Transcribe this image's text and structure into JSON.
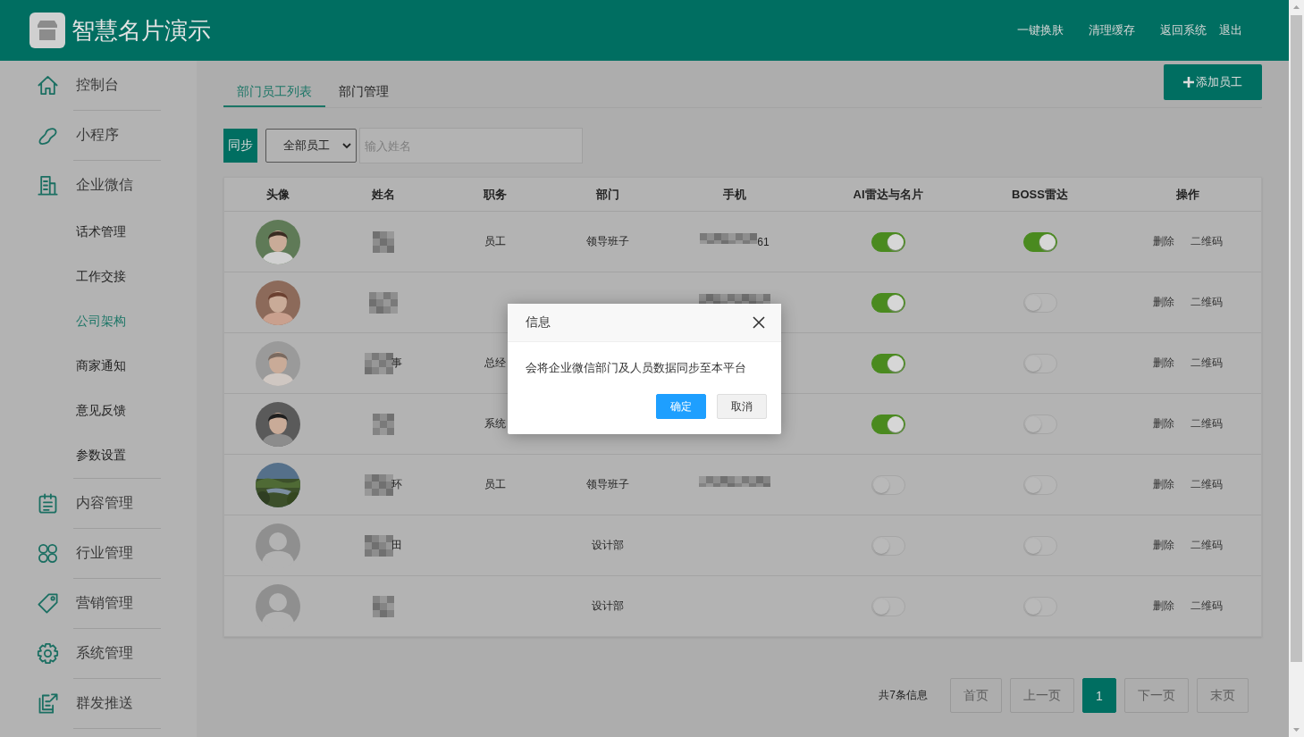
{
  "header": {
    "title": "智慧名片演示",
    "links": [
      "一键换肤",
      "清理缓存",
      "返回系统",
      "退出"
    ]
  },
  "sidebar": {
    "items": [
      {
        "label": "控制台",
        "selected": false
      },
      {
        "label": "小程序",
        "selected": false
      },
      {
        "label": "企业微信",
        "selected": false,
        "children": [
          {
            "label": "话术管理",
            "selected": false
          },
          {
            "label": "工作交接",
            "selected": false
          },
          {
            "label": "公司架构",
            "selected": true
          },
          {
            "label": "商家通知",
            "selected": false
          },
          {
            "label": "意见反馈",
            "selected": false
          },
          {
            "label": "参数设置",
            "selected": false
          }
        ]
      },
      {
        "label": "内容管理",
        "selected": false
      },
      {
        "label": "行业管理",
        "selected": false
      },
      {
        "label": "营销管理",
        "selected": false
      },
      {
        "label": "系统管理",
        "selected": false
      },
      {
        "label": "群发推送",
        "selected": false
      }
    ]
  },
  "tabs": [
    {
      "label": "部门员工列表",
      "selected": true
    },
    {
      "label": "部门管理",
      "selected": false
    }
  ],
  "add_button": "添加员工",
  "filter": {
    "sync_button": "同步",
    "select": "全部员工",
    "search": {
      "placeholder": "输入姓名"
    }
  },
  "table": {
    "columns": [
      "头像",
      "姓名",
      "职务",
      "部门",
      "手机",
      "AI雷达与名片",
      "BOSS雷达",
      "操作"
    ],
    "rows": [
      {
        "position": "员工",
        "department": "领导班子",
        "phone": {
          "blurred": true,
          "text": "61"
        },
        "ai_radar": true,
        "boss_radar": true,
        "actions": [
          "删除",
          "二维码"
        ]
      },
      {
        "phone": {
          "blurred": true
        },
        "ai_radar": true,
        "boss_radar": false,
        "actions": [
          "删除",
          "二维码"
        ]
      },
      {
        "name": "事",
        "position": "总经",
        "phone": {
          "blurred": false
        },
        "ai_radar": true,
        "boss_radar": false,
        "actions": [
          "删除",
          "二维码"
        ]
      },
      {
        "position": "系统",
        "phone": {
          "blurred": false
        },
        "ai_radar": true,
        "boss_radar": false,
        "actions": [
          "删除",
          "二维码"
        ]
      },
      {
        "name": "环",
        "position": "员工",
        "department": "领导班子",
        "phone": {
          "blurred": true
        },
        "ai_radar": false,
        "boss_radar": false,
        "actions": [
          "删除",
          "二维码"
        ]
      },
      {
        "avatar": {
          "kind": "default"
        },
        "name": "田",
        "department": "设计部",
        "phone": {
          "blurred": false
        },
        "ai_radar": false,
        "boss_radar": false,
        "actions": [
          "删除",
          "二维码"
        ]
      },
      {
        "avatar": {
          "kind": "default"
        },
        "department": "设计部",
        "phone": {
          "blurred": false
        },
        "ai_radar": false,
        "boss_radar": false,
        "actions": [
          "删除",
          "二维码"
        ]
      }
    ]
  },
  "pagination": {
    "total": "共7条信息",
    "buttons": [
      {
        "label": "首页",
        "selected": false
      },
      {
        "label": "上一页",
        "selected": false
      },
      {
        "label": "1",
        "selected": true
      },
      {
        "label": "下一页",
        "selected": false
      },
      {
        "label": "末页",
        "selected": false
      }
    ]
  },
  "dialog": {
    "title": "信息",
    "message": "会将企业微信部门及人员数据同步至本平台",
    "buttons": [
      {
        "label": "确定",
        "kind": "primary"
      },
      {
        "label": "取消",
        "kind": "secondary"
      }
    ]
  }
}
